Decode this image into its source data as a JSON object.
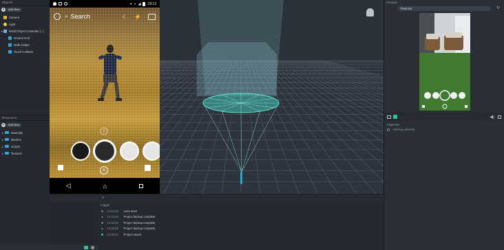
{
  "objects": {
    "title": "Objects",
    "add_label": "Add New",
    "items": [
      {
        "label": "Camera",
        "color": "#e3b23c"
      },
      {
        "label": "Light",
        "color": "#f1d447"
      },
      {
        "label": "World Object Controller [...]",
        "color": "#7fa7d9"
      },
      {
        "label": "Ground Grid",
        "color": "#3ea0d8"
      },
      {
        "label": "Math Helper",
        "color": "#3ea0d8"
      },
      {
        "label": "Touch Collision",
        "color": "#3ea0d8"
      }
    ]
  },
  "resources": {
    "title": "Resources",
    "add_label": "Add New",
    "items": [
      {
        "label": "Materials"
      },
      {
        "label": "Meshes"
      },
      {
        "label": "Scripts"
      },
      {
        "label": "Textures"
      }
    ]
  },
  "phone": {
    "time": "19:13",
    "search_label": "Search"
  },
  "preview": {
    "title": "Preview",
    "device": "Pixel pro"
  },
  "logger": {
    "title": "Logger",
    "rows": [
      {
        "time": "14:14:22",
        "text": "Lens reset"
      },
      {
        "time": "14:14:23",
        "text": "Project backup complete"
      },
      {
        "time": "14:15:25",
        "text": "Project backup complete"
      },
      {
        "time": "14:15:26",
        "text": "Project backup complete"
      },
      {
        "time": "14:16:21",
        "text": "Project saved"
      }
    ]
  },
  "inspector": {
    "title": "Inspector",
    "message": "Nothing selected"
  },
  "colors": {
    "accent": "#2bc4a8",
    "folder": "#3ea0d8"
  }
}
